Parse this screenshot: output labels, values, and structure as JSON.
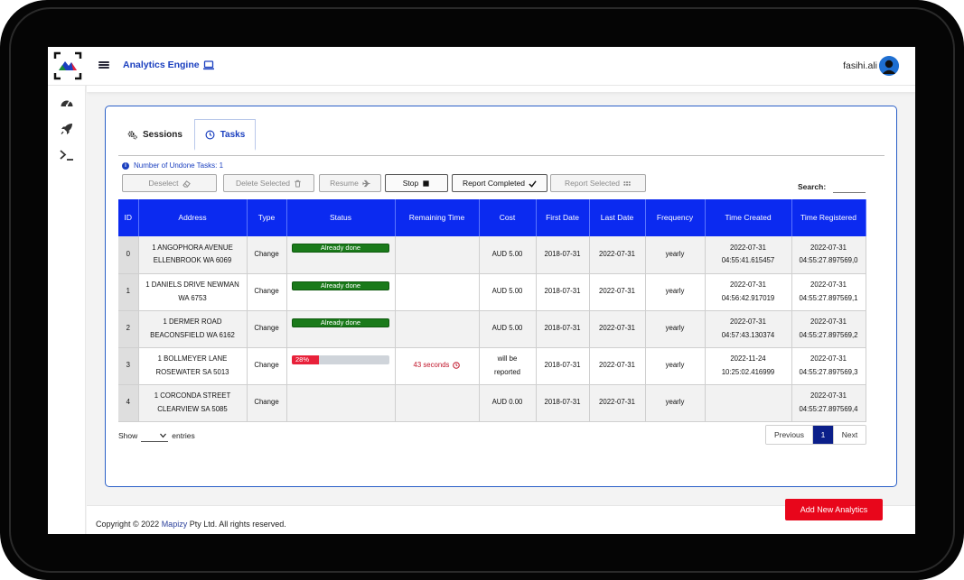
{
  "header": {
    "app_title": "Analytics Engine",
    "user_name": "fasihi.ali"
  },
  "tabs": [
    {
      "label": "Sessions",
      "icon": "gears-icon",
      "active": false
    },
    {
      "label": "Tasks",
      "icon": "clock-icon",
      "active": true
    }
  ],
  "undone_text": "Number of Undone Tasks: 1",
  "toolbar": {
    "deselect": "Deselect",
    "delete_selected": "Delete Selected",
    "resume": "Resume",
    "stop": "Stop",
    "report_completed": "Report Completed",
    "report_selected": "Report Selected"
  },
  "search": {
    "label": "Search:",
    "value": ""
  },
  "table": {
    "columns": [
      "ID",
      "Address",
      "Type",
      "Status",
      "Remaining Time",
      "Cost",
      "First Date",
      "Last Date",
      "Frequency",
      "Time Created",
      "Time Registered"
    ],
    "rows": [
      {
        "id": "0",
        "address_1": "1 ANGOPHORA AVENUE",
        "address_2": "ELLENBROOK WA 6069",
        "type": "Change",
        "status": "Already done",
        "status_kind": "done",
        "remaining": "",
        "cost_1": "AUD 5.00",
        "cost_2": "",
        "first_date": "2018-07-31",
        "last_date": "2022-07-31",
        "frequency": "yearly",
        "created_1": "2022-07-31",
        "created_2": "04:55:41.615457",
        "registered_1": "2022-07-31",
        "registered_2": "04:55:27.897569,0"
      },
      {
        "id": "1",
        "address_1": "1 DANIELS DRIVE NEWMAN",
        "address_2": "WA 6753",
        "type": "Change",
        "status": "Already done",
        "status_kind": "done",
        "remaining": "",
        "cost_1": "AUD 5.00",
        "cost_2": "",
        "first_date": "2018-07-31",
        "last_date": "2022-07-31",
        "frequency": "yearly",
        "created_1": "2022-07-31",
        "created_2": "04:56:42.917019",
        "registered_1": "2022-07-31",
        "registered_2": "04:55:27.897569,1"
      },
      {
        "id": "2",
        "address_1": "1 DERMER ROAD",
        "address_2": "BEACONSFIELD WA 6162",
        "type": "Change",
        "status": "Already done",
        "status_kind": "done",
        "remaining": "",
        "cost_1": "AUD 5.00",
        "cost_2": "",
        "first_date": "2018-07-31",
        "last_date": "2022-07-31",
        "frequency": "yearly",
        "created_1": "2022-07-31",
        "created_2": "04:57:43.130374",
        "registered_1": "2022-07-31",
        "registered_2": "04:55:27.897569,2"
      },
      {
        "id": "3",
        "address_1": "1 BOLLMEYER LANE",
        "address_2": "ROSEWATER SA 5013",
        "type": "Change",
        "status": "28%",
        "status_kind": "progress",
        "progress": 0.28,
        "remaining": "43 seconds",
        "cost_1": "will be",
        "cost_2": "reported",
        "first_date": "2018-07-31",
        "last_date": "2022-07-31",
        "frequency": "yearly",
        "created_1": "2022-11-24",
        "created_2": "10:25:02.416999",
        "registered_1": "2022-07-31",
        "registered_2": "04:55:27.897569,3"
      },
      {
        "id": "4",
        "address_1": "1 CORCONDA STREET",
        "address_2": "CLEARVIEW SA 5085",
        "type": "Change",
        "status": "",
        "status_kind": "none",
        "remaining": "",
        "cost_1": "AUD 0.00",
        "cost_2": "",
        "first_date": "2018-07-31",
        "last_date": "2022-07-31",
        "frequency": "yearly",
        "created_1": "",
        "created_2": "",
        "registered_1": "2022-07-31",
        "registered_2": "04:55:27.897569,4"
      }
    ]
  },
  "show_entries": {
    "show": "Show",
    "entries": "entries"
  },
  "pagination": {
    "previous": "Previous",
    "current": "1",
    "next": "Next"
  },
  "footer": {
    "copyright_prefix": "Copyright © 2022 ",
    "brand": "Mapizy",
    "copyright_suffix": " Pty Ltd. All rights reserved."
  },
  "add_button": "Add New Analytics",
  "colors": {
    "primary": "#0b2af0",
    "accent_red": "#e8061b",
    "success": "#1a7a1a",
    "link": "#1a3fbf"
  }
}
